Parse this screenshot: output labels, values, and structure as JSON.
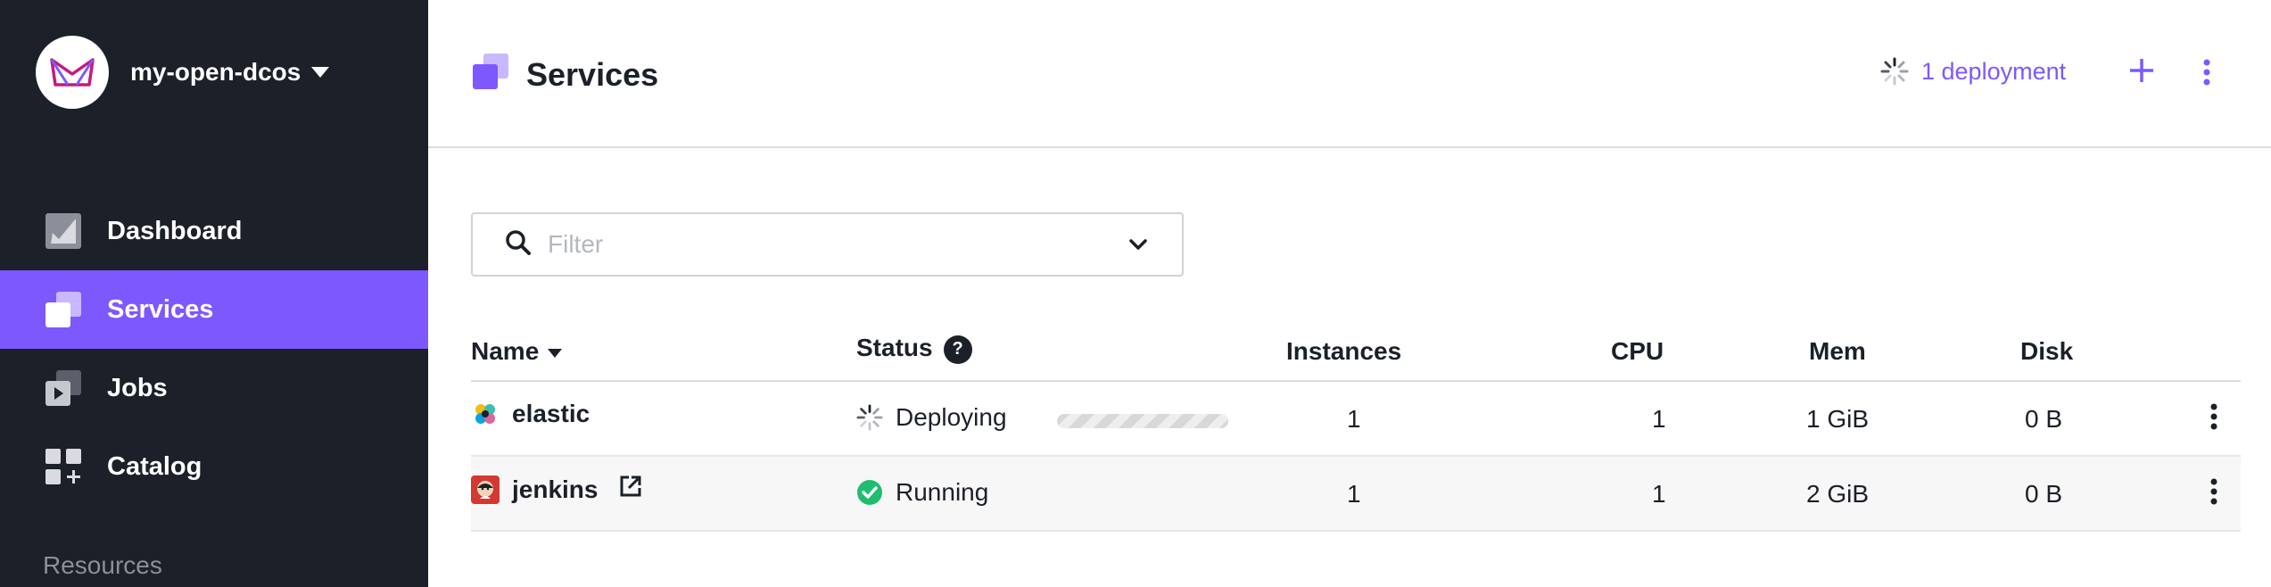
{
  "sidebar": {
    "cluster_name": "my-open-dcos",
    "items": [
      {
        "label": "Dashboard",
        "icon": "dashboard-icon"
      },
      {
        "label": "Services",
        "icon": "services-icon",
        "active": true
      },
      {
        "label": "Jobs",
        "icon": "jobs-icon"
      },
      {
        "label": "Catalog",
        "icon": "catalog-icon"
      }
    ],
    "section_label": "Resources"
  },
  "header": {
    "title": "Services",
    "deployment_label": "1 deployment",
    "add_icon": "plus-icon",
    "more_icon": "kebab-icon"
  },
  "filter": {
    "placeholder": "Filter"
  },
  "table": {
    "columns": {
      "name": "Name",
      "status": "Status",
      "instances": "Instances",
      "cpu": "CPU",
      "mem": "Mem",
      "disk": "Disk"
    },
    "rows": [
      {
        "name": "elastic",
        "status": "Deploying",
        "instances": "1",
        "cpu": "1",
        "mem": "1 GiB",
        "disk": "0 B"
      },
      {
        "name": "jenkins",
        "status": "Running",
        "instances": "1",
        "cpu": "1",
        "mem": "2 GiB",
        "disk": "0 B"
      }
    ]
  },
  "colors": {
    "accent": "#7d58ff",
    "sidebar_bg": "#1b2029",
    "running_green": "#1fbd6f"
  }
}
